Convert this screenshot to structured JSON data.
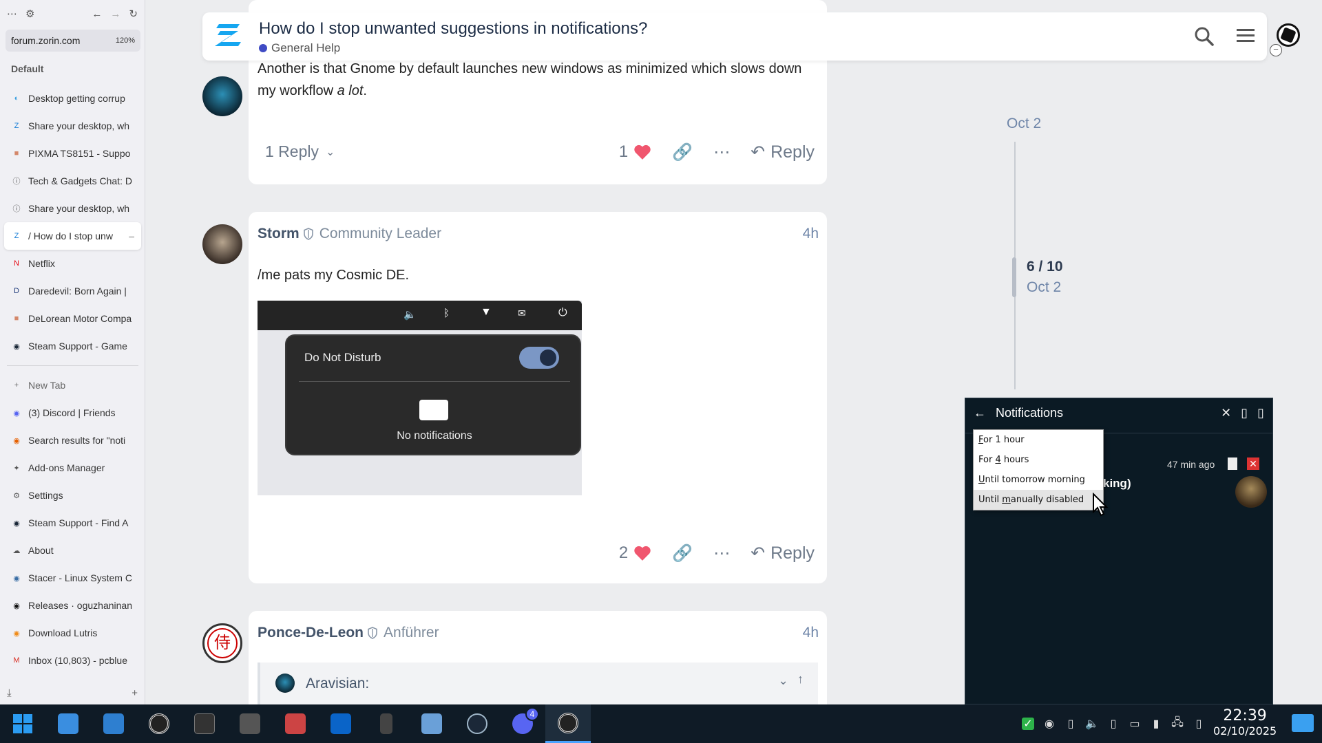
{
  "browser": {
    "url": "forum.zorin.com",
    "zoom": "120%",
    "workspace": "Default",
    "tabs": [
      {
        "label": "Desktop getting corrup",
        "icon": "discourse-icon",
        "color": "#3aa0e0"
      },
      {
        "label": "Share your desktop, wh",
        "icon": "zorin-icon",
        "color": "#1b7fd6"
      },
      {
        "label": "PIXMA TS8151 - Suppo",
        "icon": "canon-icon",
        "color": "#d4876a"
      },
      {
        "label": "Tech & Gadgets Chat: D",
        "icon": "info-icon",
        "color": "#555555"
      },
      {
        "label": "Share your desktop, wh",
        "icon": "info-icon",
        "color": "#555555"
      },
      {
        "label": "/ How do I stop unw",
        "icon": "zorin-icon",
        "color": "#1b7fd6",
        "active": true
      },
      {
        "label": "Netflix",
        "icon": "netflix-icon",
        "color": "#e50914"
      },
      {
        "label": "Daredevil: Born Again |",
        "icon": "disney-icon",
        "color": "#1e3a7a"
      },
      {
        "label": "DeLorean Motor Compa",
        "icon": "delorean-icon",
        "color": "#d4876a"
      },
      {
        "label": "Steam Support - Game",
        "icon": "steam-icon",
        "color": "#1b2838"
      }
    ],
    "new_tab_label": "New Tab",
    "pinned_tabs": [
      {
        "label": "(3) Discord | Friends",
        "icon": "discord-icon",
        "color": "#5865f2"
      },
      {
        "label": "Search results for \"noti",
        "icon": "firefox-icon",
        "color": "#e66000"
      },
      {
        "label": "Add-ons Manager",
        "icon": "puzzle-icon",
        "color": "#555555"
      },
      {
        "label": "Settings",
        "icon": "gear-icon",
        "color": "#555555"
      },
      {
        "label": "Steam Support - Find A",
        "icon": "steam-icon",
        "color": "#1b2838"
      },
      {
        "label": "About",
        "icon": "about-icon",
        "color": "#555555"
      },
      {
        "label": "Stacer - Linux System C",
        "icon": "stacer-icon",
        "color": "#3a6ea5"
      },
      {
        "label": "Releases · oguzhaninan",
        "icon": "github-icon",
        "color": "#111111"
      },
      {
        "label": "Download Lutris",
        "icon": "lutris-icon",
        "color": "#f08c1a"
      },
      {
        "label": "Inbox (10,803) - pcblue",
        "icon": "gmail-icon",
        "color": "#d93025"
      }
    ]
  },
  "forum": {
    "topic_title": "How do I stop unwanted suggestions in notifications?",
    "category": "General Help",
    "category_color": "#3f4bc4",
    "post1": {
      "text_prefix": "Another is that Gnome by default launches new windows as minimized which slows down my workflow ",
      "text_em": "a lot",
      "text_suffix": ".",
      "replies_label": "1 Reply",
      "likes": "1",
      "reply_label": "Reply"
    },
    "post2": {
      "author": "Storm",
      "role": "Community Leader",
      "time": "4h",
      "text": "/me pats my Cosmic DE.",
      "image": {
        "dnd_label": "Do Not Disturb",
        "no_notifications": "No notifications"
      },
      "likes": "2",
      "reply_label": "Reply"
    },
    "post3": {
      "author": "Ponce-De-Leon",
      "role": "Anführer",
      "time": "4h",
      "quote_author": "Aravisian:"
    },
    "timeline": {
      "date_top": "Oct 2",
      "position": "6 / 10",
      "date_bottom": "Oct 2"
    }
  },
  "notifications": {
    "title": "Notifications",
    "item_time": "47 min ago",
    "item_text_partial": "king)",
    "menu": [
      {
        "label": "For 1 hour",
        "accel": "F",
        "rest": "or 1 hour"
      },
      {
        "label": "For 4 hours",
        "pre": "For ",
        "accel": "4",
        "rest": " hours"
      },
      {
        "label": "Until tomorrow morning",
        "accel": "U",
        "rest": "ntil tomorrow morning"
      },
      {
        "label": "Until manually disabled",
        "pre": "Until ",
        "accel": "m",
        "rest": "anually disabled"
      }
    ]
  },
  "taskbar": {
    "discord_badge": "4",
    "time": "22:39",
    "date": "02/10/2025"
  }
}
